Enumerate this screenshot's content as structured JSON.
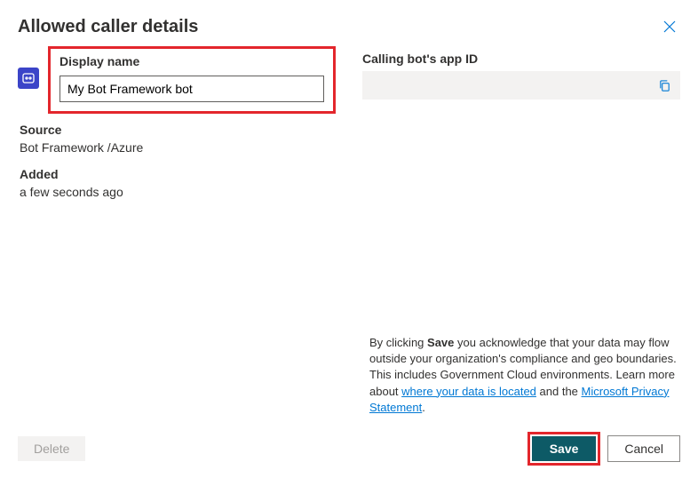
{
  "title": "Allowed caller details",
  "left": {
    "display_name_label": "Display name",
    "display_name_value": "My Bot Framework bot",
    "source_label": "Source",
    "source_value": "Bot Framework /Azure",
    "added_label": "Added",
    "added_value": "a few seconds ago"
  },
  "right": {
    "app_id_label": "Calling bot's app ID"
  },
  "disclaimer": {
    "prefix": "By clicking ",
    "save_word": "Save",
    "body": " you acknowledge that your data may flow outside your organization's compliance and geo boundaries. This includes Government Cloud environments. Learn more about ",
    "link1": "where your data is located",
    "middle": " and the ",
    "link2": "Microsoft Privacy Statement",
    "suffix": "."
  },
  "footer": {
    "delete": "Delete",
    "save": "Save",
    "cancel": "Cancel"
  }
}
